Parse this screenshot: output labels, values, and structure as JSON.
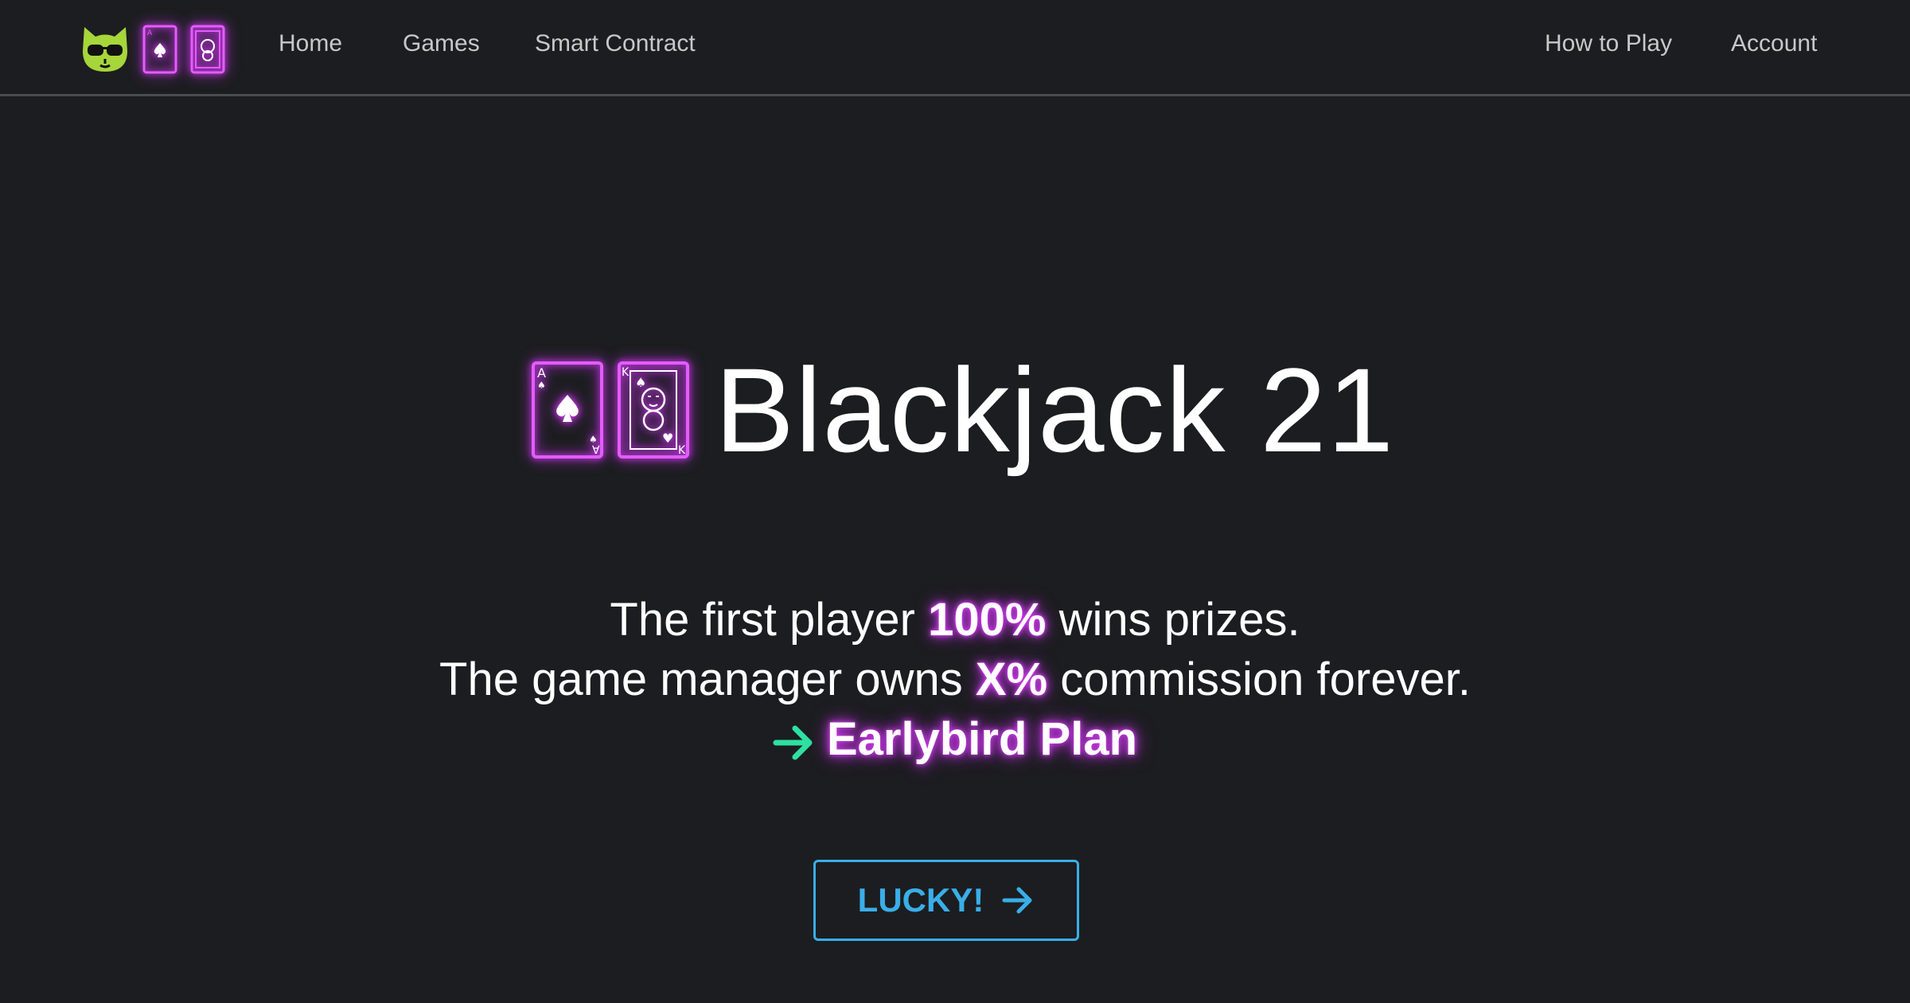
{
  "nav": {
    "links": [
      {
        "label": "Home"
      },
      {
        "label": "Games"
      },
      {
        "label": "Smart Contract"
      },
      {
        "label": "How to Play"
      },
      {
        "label": "Account"
      }
    ],
    "logo_icons": [
      "cat-sunglasses-icon",
      "ace-of-spades-card-icon",
      "king-card-icon"
    ]
  },
  "hero": {
    "title": "Blackjack 21",
    "line1_before": "The first player",
    "line1_highlight": "100%",
    "line1_after": "wins prizes.",
    "line2_before": "The game manager owns",
    "line2_highlight": "X%",
    "line2_after": "commission forever.",
    "plan_label": "Earlybird Plan",
    "cta_label": "LUCKY!"
  },
  "colors": {
    "background": "#1c1d20",
    "neon_purple": "#d43df0",
    "cta_blue": "#3aaee8",
    "arrow_green": "#2ee0a1",
    "cat_green": "#a6d63a"
  }
}
